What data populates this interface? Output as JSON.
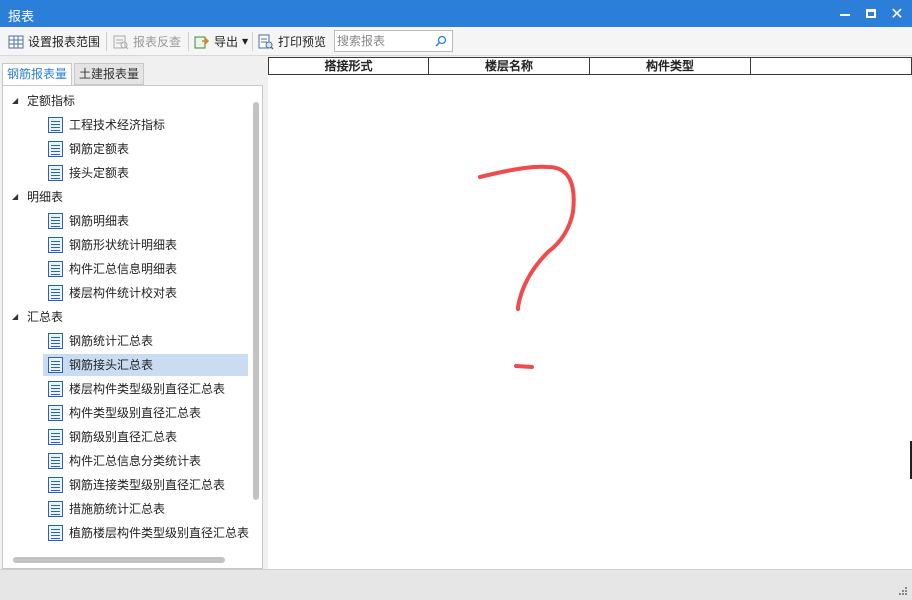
{
  "window": {
    "title": "报表"
  },
  "toolbar": {
    "set_range_label": "设置报表范围",
    "reverse_check_label": "报表反查",
    "export_label": "导出",
    "print_preview_label": "打印预览",
    "search_placeholder": "搜索报表"
  },
  "tabs": {
    "active_label": "钢筋报表量",
    "inactive_label": "土建报表量"
  },
  "tree": {
    "groups": [
      {
        "label": "定额指标",
        "items": [
          "工程技术经济指标",
          "钢筋定额表",
          "接头定额表"
        ]
      },
      {
        "label": "明细表",
        "items": [
          "钢筋明细表",
          "钢筋形状统计明细表",
          "构件汇总信息明细表",
          "楼层构件统计校对表"
        ]
      },
      {
        "label": "汇总表",
        "items": [
          "钢筋统计汇总表",
          "钢筋接头汇总表",
          "楼层构件类型级别直径汇总表",
          "构件类型级别直径汇总表",
          "钢筋级别直径汇总表",
          "构件汇总信息分类统计表",
          "钢筋连接类型级别直径汇总表",
          "措施筋统计汇总表",
          "植筋楼层构件类型级别直径汇总表"
        ]
      }
    ],
    "selected_item": "钢筋接头汇总表"
  },
  "table": {
    "columns": [
      "搭接形式",
      "楼层名称",
      "构件类型",
      ""
    ]
  },
  "colors": {
    "titlebar": "#2b7fd9",
    "selection": "#c9dcf2",
    "annotation": "#f04a4a"
  }
}
